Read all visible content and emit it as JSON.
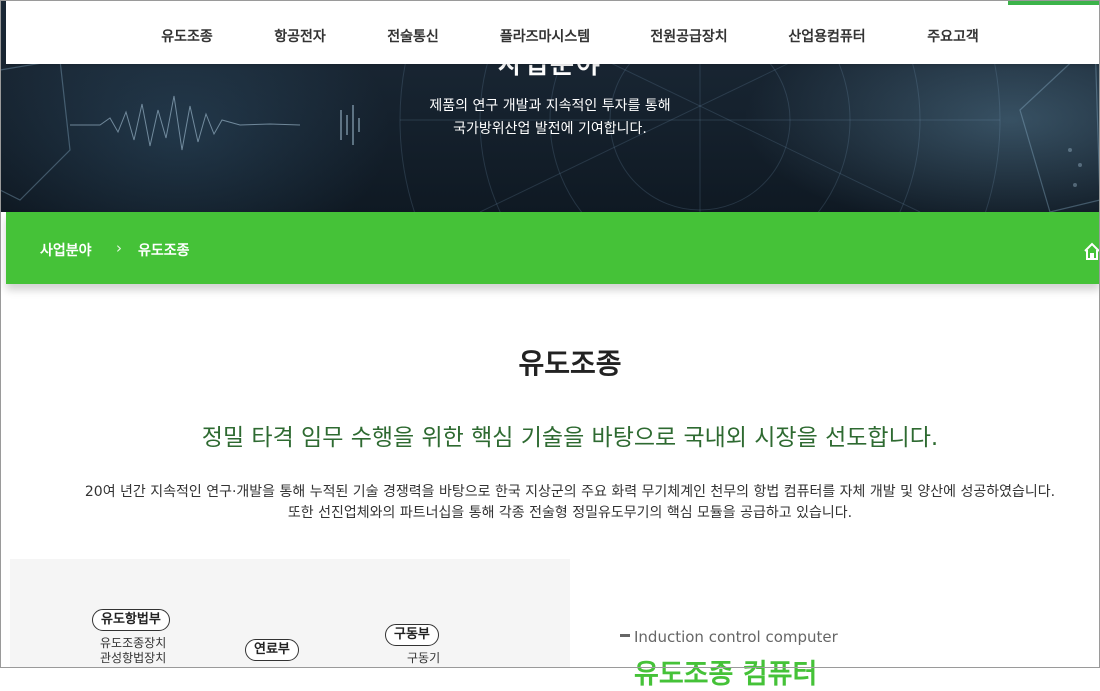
{
  "nav": {
    "items": [
      "유도조종",
      "항공전자",
      "전술통신",
      "플라즈마시스템",
      "전원공급장치",
      "산업용컴퓨터",
      "주요고객"
    ]
  },
  "hero": {
    "title": "사업분야",
    "subtitle_line1": "제품의 연구 개발과 지속적인 투자를 통해",
    "subtitle_line2": "국가방위산업 발전에 기여합니다."
  },
  "breadcrumb": {
    "root": "사업분야",
    "separator": "›",
    "current": "유도조종",
    "home_icon": "home-icon"
  },
  "content": {
    "title": "유도조종",
    "tagline": "정밀 타격 임무 수행을 위한 핵심 기술을 바탕으로 국내외 시장을 선도합니다.",
    "desc_line1": "20여 년간 지속적인 연구·개발을 통해 누적된 기술 경쟁력을 바탕으로 한국 지상군의 주요 화력 무기체계인 천무의 항법 컴퓨터를 자체 개발 및 양산에 성공하였습니다.",
    "desc_line2": "또한 선진업체와의 파트너십을 통해 각종 전술형 정밀유도무기의 핵심 모듈을 공급하고 있습니다."
  },
  "diagram": {
    "nav_module": {
      "label": "유도항법부",
      "lines": [
        "유도조종장치",
        "관성항법장치"
      ]
    },
    "fuel_module": {
      "label": "연료부"
    },
    "drive_module": {
      "label": "구동부",
      "lines": [
        "구동기"
      ]
    }
  },
  "product": {
    "label_en": "Induction control computer",
    "name_ko": "유도조종 컴퓨터"
  },
  "colors": {
    "brand_green": "#45c238",
    "tagline_green": "#2e6a31",
    "hero_dark": "#15212d"
  }
}
